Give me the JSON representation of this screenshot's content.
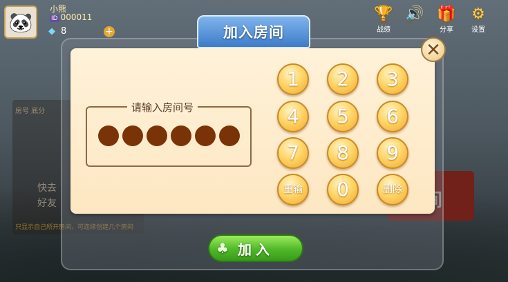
{
  "user": {
    "name": "小熊",
    "id_tag": "ID",
    "id": "000011",
    "gems": "8"
  },
  "top_icons": [
    {
      "label": "战绩",
      "icon": "trophy-icon"
    },
    {
      "label": "",
      "icon": "speaker-icon"
    },
    {
      "label": "分享",
      "icon": "share-icon"
    },
    {
      "label": "设置",
      "icon": "gear-icon"
    }
  ],
  "dialog": {
    "title": "加入房间",
    "input_label": "请输入房间号",
    "entered_digits": 6,
    "join_label": "加入",
    "close_icon": "close-icon"
  },
  "keypad": {
    "row1": [
      "1",
      "2",
      "3"
    ],
    "row2": [
      "4",
      "5",
      "6"
    ],
    "row3": [
      "7",
      "8",
      "9"
    ],
    "row4": [
      "重输",
      "0",
      "删除"
    ]
  },
  "background": {
    "table_headers": "房号   底分",
    "hint_lines": [
      "快去",
      "好友"
    ],
    "note": "只显示自己所开房间，可连续创建几个房间",
    "right_button_partial": "间"
  },
  "colors": {
    "dialog_bg": "#fde7c2",
    "key_gold": "#ffd66a",
    "dot": "#7a3306",
    "join_green": "#4fb82a",
    "title_blue": "#3e7cc9"
  }
}
